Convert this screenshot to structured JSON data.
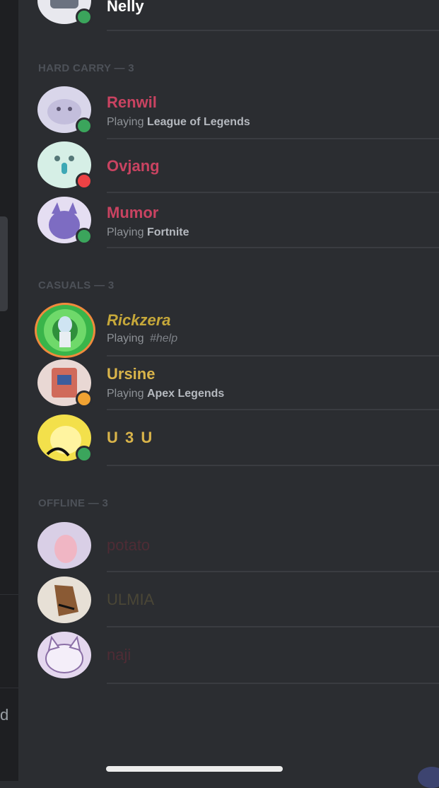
{
  "rail": {
    "partial_text": "d"
  },
  "top_member": {
    "name": "Nelly",
    "name_color": "#ffffff",
    "status": "online"
  },
  "groups": [
    {
      "header": "HARD CARRY — 3",
      "members": [
        {
          "name": "Renwil",
          "name_color": "#c94361",
          "playing_label": "Playing",
          "game": "League of Legends",
          "status": "online",
          "status_color": "#3ba55c",
          "avatar_bg": "#d9d6ea"
        },
        {
          "name": "Ovjang",
          "name_color": "#c94361",
          "playing_label": "",
          "game": "",
          "status": "dnd",
          "status_color": "#ed4245",
          "avatar_bg": "#d6efe6"
        },
        {
          "name": "Mumor",
          "name_color": "#c94361",
          "playing_label": "Playing",
          "game": "Fortnite",
          "status": "online",
          "status_color": "#3ba55c",
          "avatar_bg": "#e5def2"
        }
      ]
    },
    {
      "header": "CASUALS — 3",
      "members": [
        {
          "name": "Rickzera",
          "name_color": "#c6a83a",
          "playing_label": "Playing",
          "game": "#help",
          "status": "none",
          "status_color": "",
          "avatar_bg": "#39b54a"
        },
        {
          "name": "Ursine",
          "name_color": "#d9b44a",
          "playing_label": "Playing",
          "game": "Apex Legends",
          "status": "idle",
          "status_color": "#f0a232",
          "avatar_bg": "#e9d8d4"
        },
        {
          "name": "U 3 U",
          "name_color": "#d9b44a",
          "playing_label": "",
          "game": "",
          "status": "online",
          "status_color": "#3ba55c",
          "avatar_bg": "#f3e04b"
        }
      ]
    },
    {
      "header": "OFFLINE — 3",
      "members": [
        {
          "name": "potato",
          "name_color": "#4e2c35",
          "playing_label": "",
          "game": "",
          "status": "offline",
          "status_color": "",
          "avatar_bg": "#d9cfe6"
        },
        {
          "name": "ULMIA",
          "name_color": "#4a4636",
          "playing_label": "",
          "game": "",
          "status": "offline",
          "status_color": "",
          "avatar_bg": "#e7e0d6"
        },
        {
          "name": "naji",
          "name_color": "#4e2c35",
          "playing_label": "",
          "game": "",
          "status": "offline",
          "status_color": "",
          "avatar_bg": "#e4d7ee"
        }
      ]
    }
  ]
}
